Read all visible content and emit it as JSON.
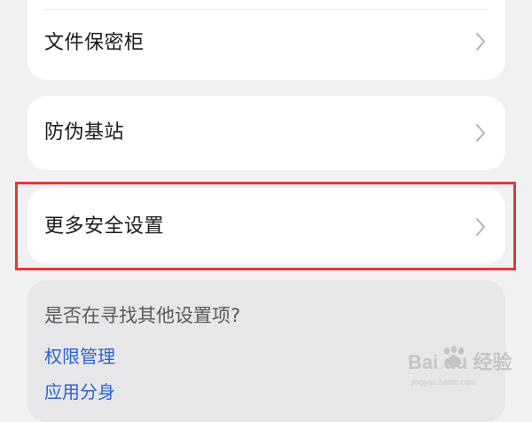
{
  "settings_list": {
    "file_vault": {
      "label": "文件保密柜",
      "icon": "chevron-right-icon"
    },
    "fake_base_station": {
      "label": "防伪基站",
      "icon": "chevron-right-icon"
    },
    "more_security": {
      "label": "更多安全设置",
      "icon": "chevron-right-icon",
      "highlighted": true
    }
  },
  "suggestions": {
    "title": "是否在寻找其他设置项?",
    "links": [
      {
        "label": "权限管理"
      },
      {
        "label": "应用分身"
      }
    ]
  },
  "watermark": {
    "logo_text": "Bai du 经验",
    "sub_text": "jingyan.baidu.com"
  },
  "colors": {
    "background": "#f1f1f3",
    "card": "#ffffff",
    "suggest_card": "#e7e7ea",
    "link": "#2a63d4",
    "highlight": "#e53935",
    "chevron": "#b3b3b3"
  }
}
